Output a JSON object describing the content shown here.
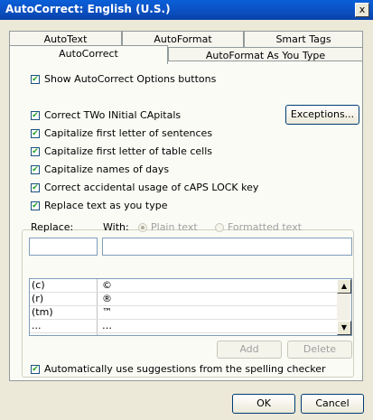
{
  "window": {
    "title": "AutoCorrect: English (U.S.)",
    "close_glyph": "x"
  },
  "tabs": {
    "row1": [
      "AutoText",
      "AutoFormat",
      "Smart Tags"
    ],
    "row2": [
      "AutoCorrect",
      "AutoFormat As You Type"
    ],
    "active": "AutoCorrect"
  },
  "options": {
    "show_buttons": {
      "label": "Show AutoCorrect Options buttons",
      "checked": true
    },
    "two_initial_caps": {
      "label": "Correct TWo INitial CApitals",
      "checked": true
    },
    "first_letter_sentences": {
      "label": "Capitalize first letter of sentences",
      "checked": true
    },
    "first_letter_table": {
      "label": "Capitalize first letter of table cells",
      "checked": true
    },
    "names_of_days": {
      "label": "Capitalize names of days",
      "checked": true
    },
    "caps_lock": {
      "label": "Correct accidental usage of cAPS LOCK key",
      "checked": true
    },
    "replace_as_type": {
      "label": "Replace text as you type",
      "checked": true
    },
    "spelling_suggestions": {
      "label": "Automatically use suggestions from the spelling checker",
      "checked": true
    }
  },
  "buttons": {
    "exceptions": "Exceptions...",
    "add": "Add",
    "delete": "Delete",
    "ok": "OK",
    "cancel": "Cancel"
  },
  "replace": {
    "replace_label": "Replace:",
    "with_label": "With:",
    "plain_text": "Plain text",
    "formatted_text": "Formatted text",
    "replace_value": "",
    "with_value": ""
  },
  "entries": [
    {
      "replace": "(c)",
      "with": "©"
    },
    {
      "replace": "(r)",
      "with": "®"
    },
    {
      "replace": "(tm)",
      "with": "™"
    },
    {
      "replace": "...",
      "with": "…"
    }
  ],
  "check_glyph": "✔",
  "scroll": {
    "up": "▲",
    "down": "▼"
  }
}
